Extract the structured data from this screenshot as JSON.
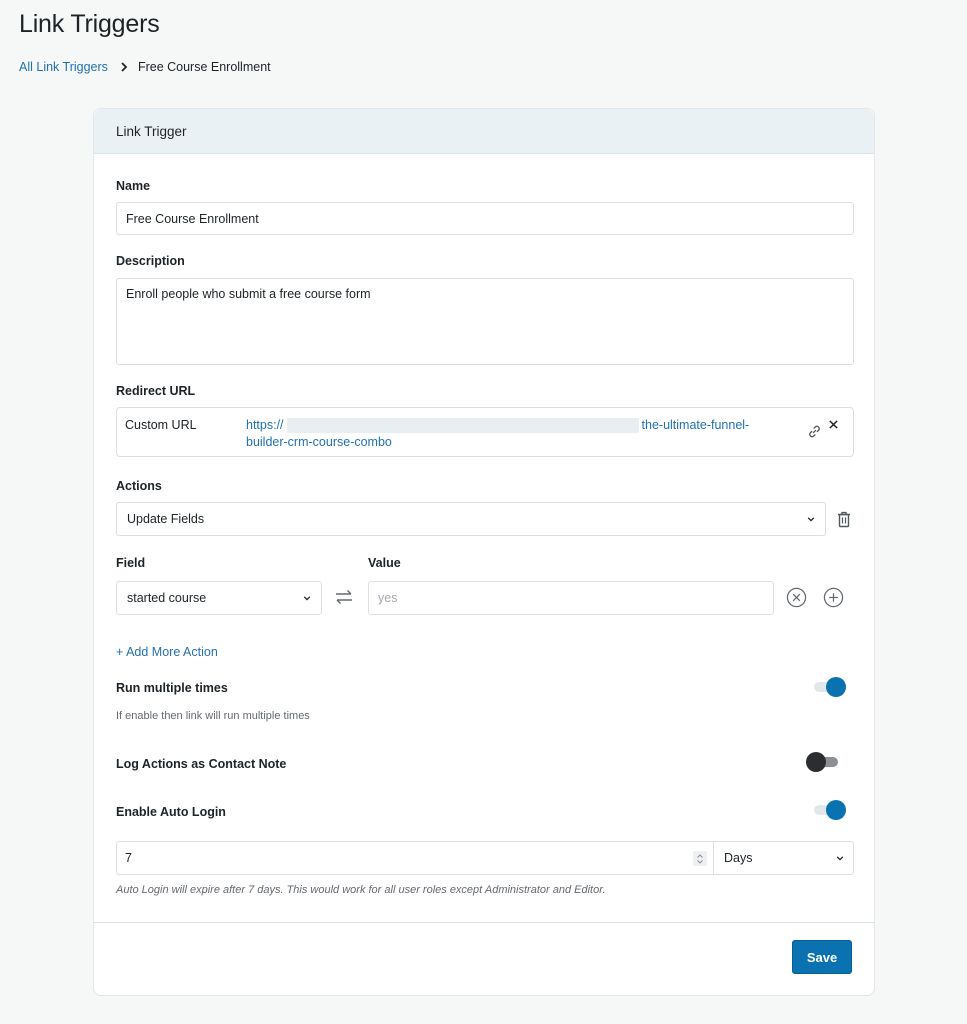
{
  "page": {
    "title": "Link Triggers"
  },
  "breadcrumb": {
    "parent_label": "All Link Triggers",
    "current_label": "Free Course Enrollment"
  },
  "card": {
    "title": "Link Trigger",
    "name": {
      "label": "Name",
      "value": "Free Course Enrollment"
    },
    "description": {
      "label": "Description",
      "value": "Enroll people who submit a free course form"
    },
    "redirect_url": {
      "label": "Redirect URL",
      "type_label": "Custom URL",
      "url_prefix": "https://",
      "url_suffix_line1": "the-ultimate-funnel-",
      "url_line2": "builder-crm-course-combo",
      "link_icon": "link-icon",
      "remove_icon": "close-icon"
    },
    "actions": {
      "label": "Actions",
      "selected_action": "Update Fields",
      "delete_icon": "trash-icon",
      "field_label": "Field",
      "value_label": "Value",
      "field_selected": "started course",
      "value_placeholder": "yes",
      "swap_icon": "swap-arrows-icon",
      "remove_row_icon": "circle-x-icon",
      "add_row_icon": "circle-plus-icon",
      "add_more_label": "+ Add More Action"
    },
    "run_multiple": {
      "label": "Run multiple times",
      "hint": "If enable then link will run multiple times",
      "enabled": true
    },
    "log_actions": {
      "label": "Log Actions as Contact Note",
      "enabled": false
    },
    "auto_login": {
      "label": "Enable Auto Login",
      "enabled": true,
      "duration_value": "7",
      "duration_unit": "Days",
      "hint": "Auto Login will expire after 7 days. This would work for all user roles except Administrator and Editor."
    },
    "save_label": "Save"
  },
  "colors": {
    "accent": "#0a72b1",
    "link": "#2271b1",
    "header_bg": "#eaf1f4",
    "toggle_off_knob": "#2c2d30"
  }
}
